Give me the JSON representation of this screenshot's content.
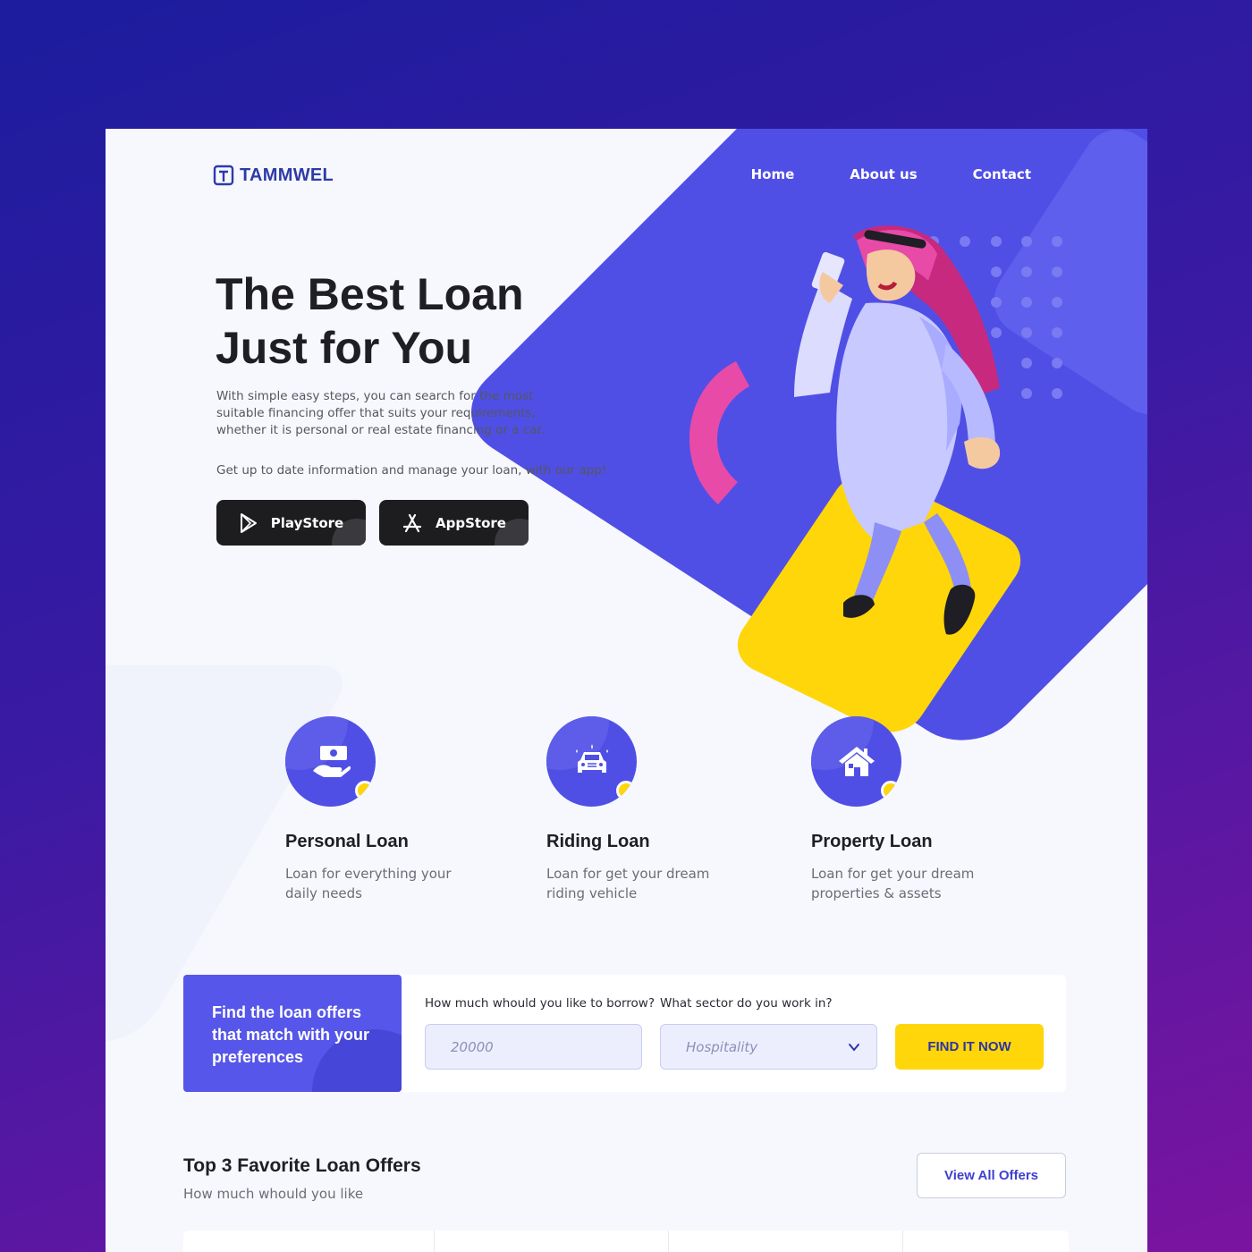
{
  "brand": {
    "name": "TAMMWEL"
  },
  "nav": {
    "items": [
      "Home",
      "About us",
      "Contact"
    ]
  },
  "hero": {
    "title_line1": "The Best Loan",
    "title_line2": "Just for You",
    "description": "With simple easy steps, you can search for the most suitable financing offer that suits your requirements, whether it is personal or real estate financing or a car.",
    "app_text": "Get up to date information and manage your loan, with our app!",
    "playstore_label": "PlayStore",
    "appstore_label": "AppStore"
  },
  "loans": [
    {
      "title": "Personal Loan",
      "desc": "Loan for everything your daily needs",
      "icon": "money-hand-icon"
    },
    {
      "title": "Riding Loan",
      "desc": "Loan for get your dream riding vehicle",
      "icon": "car-icon"
    },
    {
      "title": "Property Loan",
      "desc": "Loan for get your dream properties & assets",
      "icon": "house-icon"
    }
  ],
  "search": {
    "promo": "Find the loan offers that match with your preferences",
    "amount_label": "How much whould you like to borrow?",
    "amount_placeholder": "20000",
    "sector_label": "What sector do you work in?",
    "sector_value": "Hospitality",
    "find_button": "FIND IT NOW"
  },
  "offers": {
    "title": "Top 3 Favorite Loan Offers",
    "subtitle": "How much whould you like",
    "view_all": "View All Offers"
  },
  "colors": {
    "primary": "#4f4fe6",
    "accent_yellow": "#ffd60a",
    "accent_pink": "#e84aa8",
    "dark": "#1e1e24",
    "background_gradient_start": "#1c1c9e",
    "background_gradient_end": "#7a14a0"
  }
}
